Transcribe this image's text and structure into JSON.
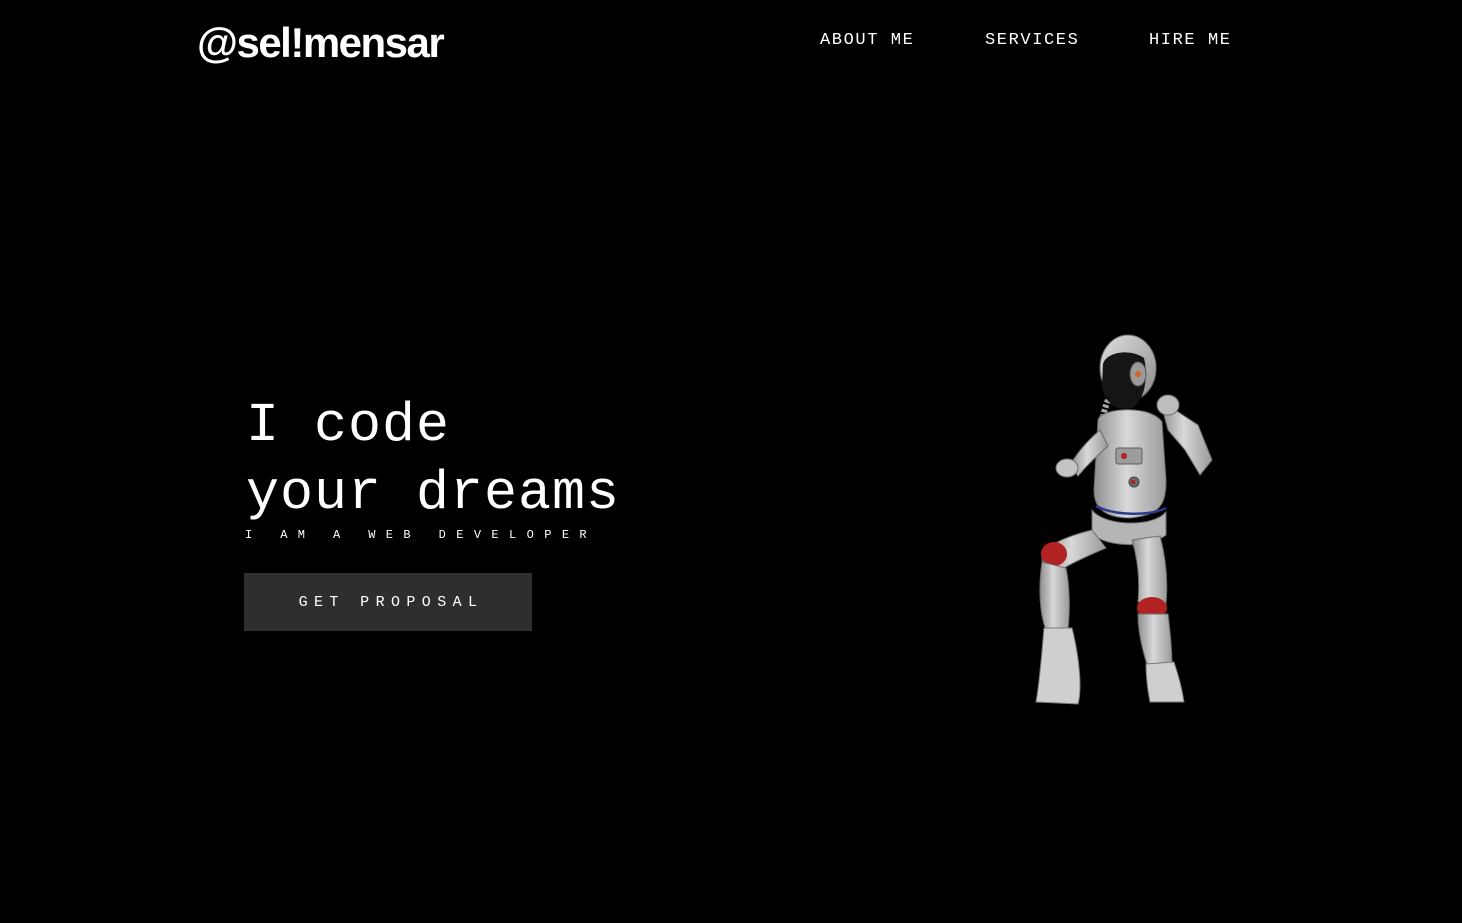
{
  "brand": {
    "logo_text": "@sel!mensar"
  },
  "nav": {
    "items": [
      {
        "label": "ABOUT ME"
      },
      {
        "label": "SERVICES"
      },
      {
        "label": "HIRE ME"
      }
    ]
  },
  "hero": {
    "title_line1": "I code",
    "title_line2": "your dreams",
    "subtitle": "I AM A WEB DEVELOPER",
    "cta_label": "GET PROPOSAL",
    "illustration": "astronaut-illustration"
  },
  "colors": {
    "background": "#000000",
    "text": "#ffffff",
    "button_bg": "#2e2e2e",
    "suit": "#c9c9c9",
    "suit_accent": "#b22222",
    "visor": "#151515"
  }
}
